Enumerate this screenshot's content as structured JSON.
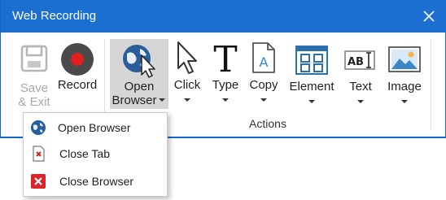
{
  "window": {
    "title": "Web Recording"
  },
  "toolbar": {
    "save_exit": {
      "line1": "Save",
      "line2": "& Exit",
      "enabled": false
    },
    "record": {
      "label": "Record"
    },
    "open_browser": {
      "line1": "Open",
      "line2": "Browser"
    },
    "click": {
      "label": "Click"
    },
    "type": {
      "label": "Type"
    },
    "copy": {
      "label": "Copy"
    },
    "element": {
      "label": "Element"
    },
    "text": {
      "label": "Text"
    },
    "image": {
      "label": "Image"
    },
    "group_label": "Actions"
  },
  "dropdown": {
    "items": [
      {
        "label": "Open Browser",
        "icon": "globe-icon"
      },
      {
        "label": "Close Tab",
        "icon": "close-tab-icon"
      },
      {
        "label": "Close Browser",
        "icon": "close-browser-icon"
      }
    ]
  },
  "colors": {
    "titlebar": "#1a6fd0",
    "record_red": "#e02020",
    "selected_bg": "#d6d6d6"
  }
}
